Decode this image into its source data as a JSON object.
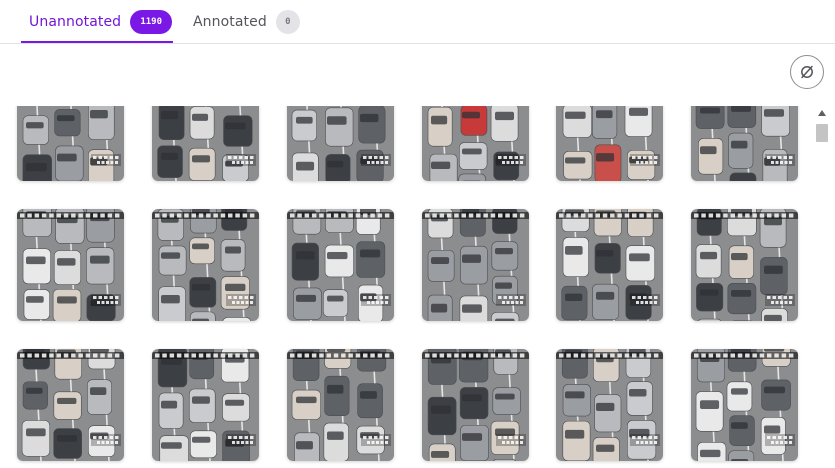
{
  "tabs": [
    {
      "label": "Unannotated",
      "count": "1190",
      "active": true
    },
    {
      "label": "Annotated",
      "count": "0",
      "active": false
    }
  ],
  "toolbar": {
    "hide_icon": "eye-off-icon"
  },
  "grid": {
    "rows": 3,
    "columns": 6,
    "tile_count": 18,
    "thumbnail_kind": "traffic-camera-frame"
  },
  "colors": {
    "accent": "#7a18e6",
    "tab_inactive_text": "#55555c",
    "badge_muted_bg": "#e4e4e8",
    "road": "#8c8d8f"
  }
}
